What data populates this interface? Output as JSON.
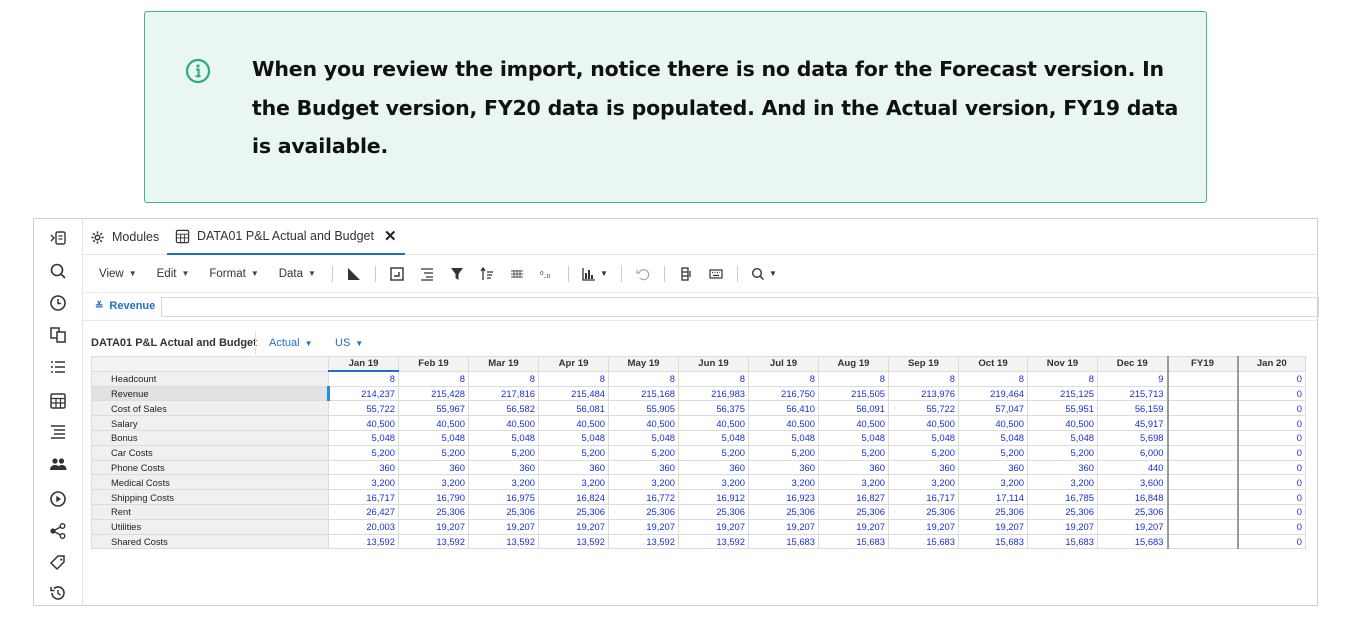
{
  "callout": {
    "icon": "info-icon",
    "message": "When you review the import, notice there is no data for the Forecast version. In the Budget version, FY20 data is populated. And in the Actual version, FY19 data is available."
  },
  "tabs": {
    "modules": "Modules",
    "active": "DATA01 P&L Actual and Budget",
    "close": "✕"
  },
  "toolbar": {
    "view": "View",
    "edit": "Edit",
    "format": "Format",
    "data": "Data"
  },
  "pagebar": {
    "dimension": "Revenue"
  },
  "grid_header": {
    "title": "DATA01 P&L Actual and Budget",
    "version": "Actual",
    "currency": "US"
  },
  "grid": {
    "columns": [
      "Jan 19",
      "Feb 19",
      "Mar 19",
      "Apr 19",
      "May 19",
      "Jun 19",
      "Jul 19",
      "Aug 19",
      "Sep 19",
      "Oct 19",
      "Nov 19",
      "Dec 19",
      "FY19",
      "Jan 20"
    ],
    "rows": [
      {
        "label": "Headcount",
        "values": [
          "8",
          "8",
          "8",
          "8",
          "8",
          "8",
          "8",
          "8",
          "8",
          "8",
          "8",
          "9",
          "",
          "0"
        ]
      },
      {
        "label": "Revenue",
        "values": [
          "214,237",
          "215,428",
          "217,816",
          "215,484",
          "215,168",
          "216,983",
          "216,750",
          "215,505",
          "213,976",
          "219,464",
          "215,125",
          "215,713",
          "",
          "0"
        ]
      },
      {
        "label": "Cost of Sales",
        "values": [
          "55,722",
          "55,967",
          "56,582",
          "56,081",
          "55,905",
          "56,375",
          "56,410",
          "56,091",
          "55,722",
          "57,047",
          "55,951",
          "56,159",
          "",
          "0"
        ]
      },
      {
        "label": "Salary",
        "values": [
          "40,500",
          "40,500",
          "40,500",
          "40,500",
          "40,500",
          "40,500",
          "40,500",
          "40,500",
          "40,500",
          "40,500",
          "40,500",
          "45,917",
          "",
          "0"
        ]
      },
      {
        "label": "Bonus",
        "values": [
          "5,048",
          "5,048",
          "5,048",
          "5,048",
          "5,048",
          "5,048",
          "5,048",
          "5,048",
          "5,048",
          "5,048",
          "5,048",
          "5,698",
          "",
          "0"
        ]
      },
      {
        "label": "Car Costs",
        "values": [
          "5,200",
          "5,200",
          "5,200",
          "5,200",
          "5,200",
          "5,200",
          "5,200",
          "5,200",
          "5,200",
          "5,200",
          "5,200",
          "6,000",
          "",
          "0"
        ]
      },
      {
        "label": "Phone Costs",
        "values": [
          "360",
          "360",
          "360",
          "360",
          "360",
          "360",
          "360",
          "360",
          "360",
          "360",
          "360",
          "440",
          "",
          "0"
        ]
      },
      {
        "label": "Medical Costs",
        "values": [
          "3,200",
          "3,200",
          "3,200",
          "3,200",
          "3,200",
          "3,200",
          "3,200",
          "3,200",
          "3,200",
          "3,200",
          "3,200",
          "3,600",
          "",
          "0"
        ]
      },
      {
        "label": "Shipping Costs",
        "values": [
          "16,717",
          "16,790",
          "16,975",
          "16,824",
          "16,772",
          "16,912",
          "16,923",
          "16,827",
          "16,717",
          "17,114",
          "16,785",
          "16,848",
          "",
          "0"
        ]
      },
      {
        "label": "Rent",
        "values": [
          "26,427",
          "25,306",
          "25,306",
          "25,306",
          "25,306",
          "25,306",
          "25,306",
          "25,306",
          "25,306",
          "25,306",
          "25,306",
          "25,306",
          "",
          "0"
        ]
      },
      {
        "label": "Utilities",
        "values": [
          "20,003",
          "19,207",
          "19,207",
          "19,207",
          "19,207",
          "19,207",
          "19,207",
          "19,207",
          "19,207",
          "19,207",
          "19,207",
          "19,207",
          "",
          "0"
        ]
      },
      {
        "label": "Shared Costs",
        "values": [
          "13,592",
          "13,592",
          "13,592",
          "13,592",
          "13,592",
          "13,592",
          "15,683",
          "15,683",
          "15,683",
          "15,683",
          "15,683",
          "15,683",
          "",
          "0"
        ]
      }
    ]
  }
}
